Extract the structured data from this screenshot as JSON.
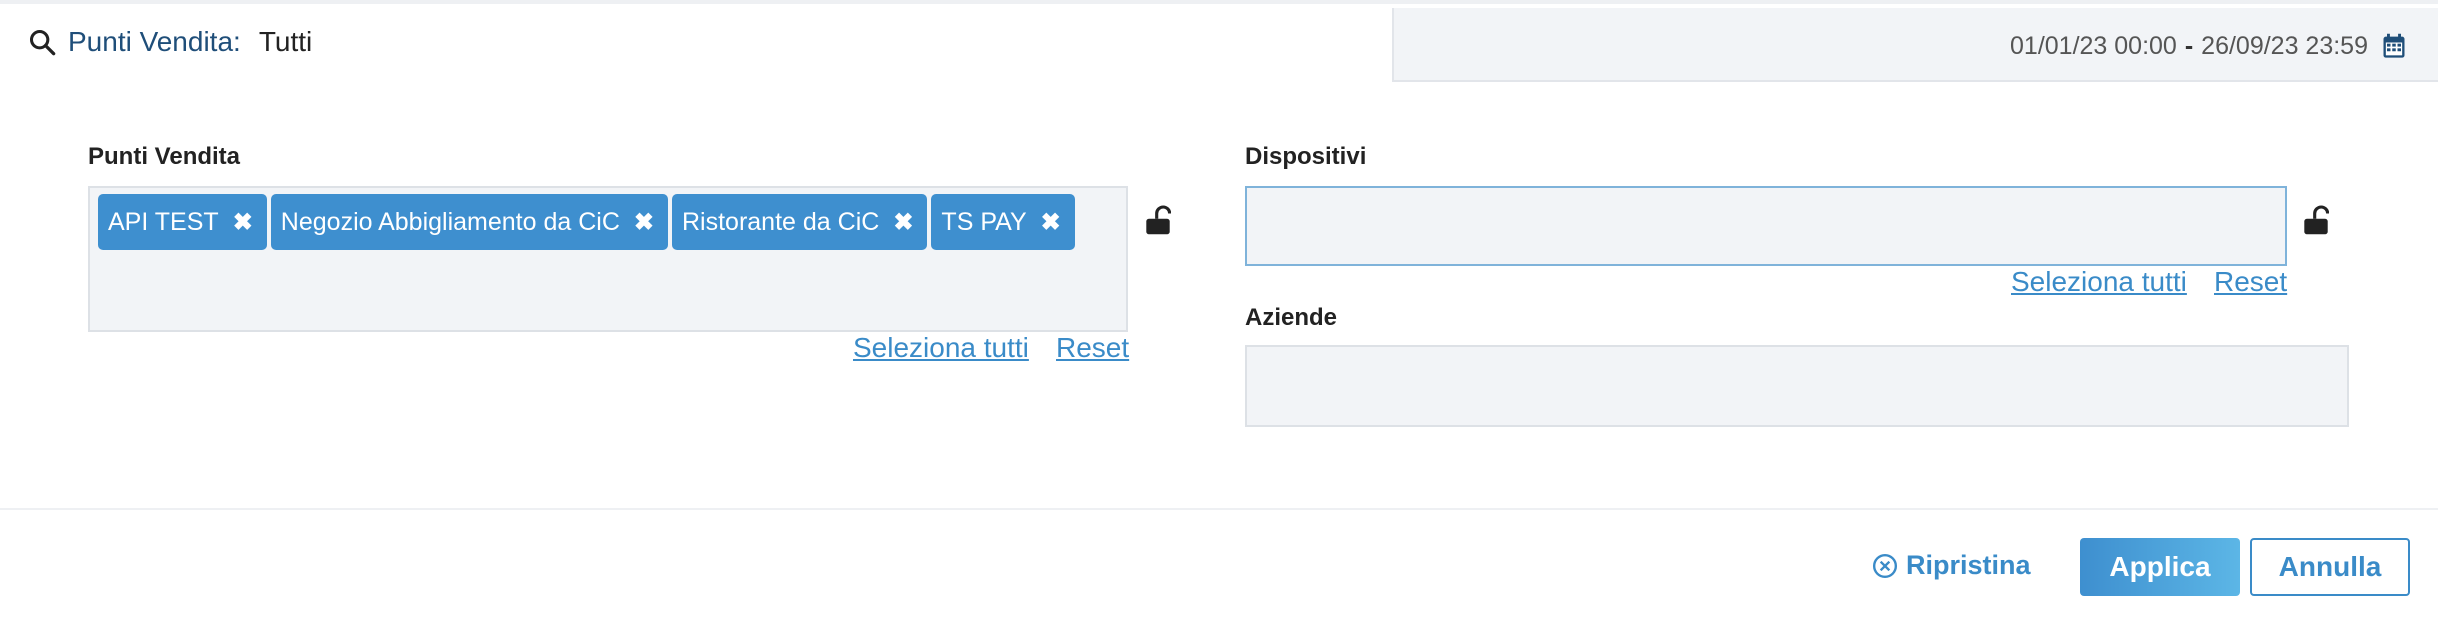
{
  "header": {
    "filter_label": "Punti Vendita:",
    "filter_value": "Tutti",
    "date_start": "01/01/23 00:00",
    "date_separator": "-",
    "date_end": "26/09/23 23:59"
  },
  "punti_vendita": {
    "label": "Punti Vendita",
    "chips": [
      "API TEST",
      "Negozio Abbigliamento da CiC",
      "Ristorante da CiC",
      "TS PAY"
    ],
    "select_all": "Seleziona tutti",
    "reset": "Reset"
  },
  "dispositivi": {
    "label": "Dispositivi",
    "select_all": "Seleziona tutti",
    "reset": "Reset"
  },
  "aziende": {
    "label": "Aziende"
  },
  "footer": {
    "ripristina": "Ripristina",
    "applica": "Applica",
    "annulla": "Annulla"
  },
  "colors": {
    "accent": "#3e8fcf",
    "link": "#3a8bc8",
    "field_bg": "#f2f4f7"
  },
  "icons": [
    "search-icon",
    "calendar-icon",
    "chip-remove-icon",
    "unlock-icon",
    "circle-x-icon"
  ]
}
